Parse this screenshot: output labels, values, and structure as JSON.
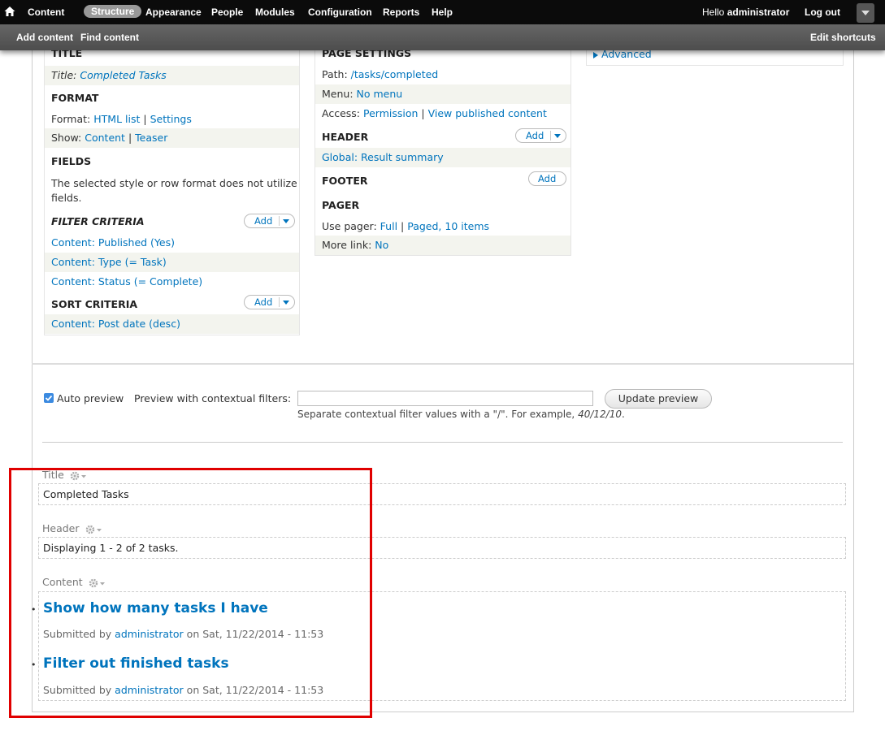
{
  "toolbar": {
    "items": [
      "Content",
      "Structure",
      "Appearance",
      "People",
      "Modules",
      "Configuration",
      "Reports",
      "Help"
    ],
    "greeting_prefix": "Hello ",
    "username": "administrator",
    "logout": "Log out"
  },
  "shortcuts": {
    "add_content": "Add content",
    "find_content": "Find content",
    "edit_shortcuts": "Edit shortcuts"
  },
  "col1": {
    "title_hdr": "TITLE",
    "title_label": "Title:",
    "title_value": "Completed Tasks",
    "format_hdr": "FORMAT",
    "format_label": "Format:",
    "format_value": "HTML list",
    "format_sep": "|",
    "format_settings": "Settings",
    "show_label": "Show:",
    "show_value": "Content",
    "show_sep": "|",
    "show_teaser": "Teaser",
    "fields_hdr": "FIELDS",
    "fields_text_1": "The selected style or row format does not utilize",
    "fields_text_2": "fields.",
    "filter_hdr": "FILTER CRITERIA",
    "filter_add": "Add",
    "filters": [
      "Content: Published (Yes)",
      "Content: Type (= Task)",
      "Content: Status (= Complete)"
    ],
    "sort_hdr": "SORT CRITERIA",
    "sort_add": "Add",
    "sorts": [
      "Content: Post date (desc)"
    ]
  },
  "col2": {
    "page_hdr": "PAGE SETTINGS",
    "path_label": "Path:",
    "path_value": "/tasks/completed",
    "menu_label": "Menu:",
    "menu_value": "No menu",
    "access_label": "Access:",
    "access_value": "Permission",
    "access_sep": "|",
    "access_view": "View published content",
    "header_hdr": "HEADER",
    "header_add": "Add",
    "header_item": "Global: Result summary",
    "footer_hdr": "FOOTER",
    "footer_add": "Add",
    "pager_hdr": "PAGER",
    "pager_label": "Use pager:",
    "pager_value": "Full",
    "pager_sep": "|",
    "pager_items": "Paged, 10 items",
    "more_label": "More link:",
    "more_value": "No"
  },
  "col3": {
    "advanced": "Advanced"
  },
  "preview": {
    "auto_preview": "Auto preview",
    "contextual_label": "Preview with contextual filters:",
    "input_value": "",
    "update_button": "Update preview",
    "hint_prefix": "Separate contextual filter values with a \"/\". For example, ",
    "hint_example": "40/12/10",
    "hint_suffix": "."
  },
  "result": {
    "title_label": "Title",
    "title_value": "Completed Tasks",
    "header_label": "Header",
    "header_value": "Displaying 1 - 2 of 2 tasks.",
    "content_label": "Content",
    "nodes": [
      {
        "title": "Show how many tasks I have",
        "sub_prefix": "Submitted by ",
        "author": "administrator",
        "sub_suffix": " on Sat, 11/22/2014 - 11:53"
      },
      {
        "title": "Filter out finished tasks",
        "sub_prefix": "Submitted by ",
        "author": "administrator",
        "sub_suffix": " on Sat, 11/22/2014 - 11:53"
      }
    ]
  },
  "colors": {
    "link": "#0074bd",
    "toolbar_bg": "#0b0b0b",
    "shortcut_bg": "#555555",
    "highlight_box": "#e00000",
    "checkbox": "#3b8ae0"
  }
}
